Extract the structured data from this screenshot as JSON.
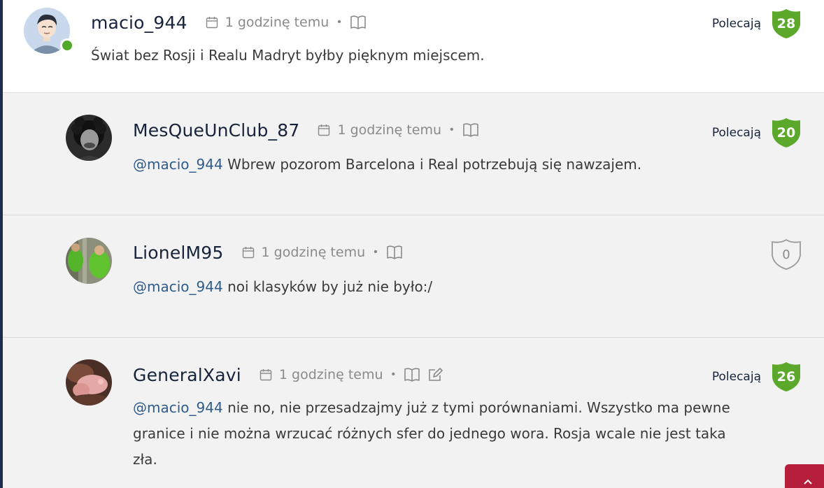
{
  "comments": [
    {
      "username": "macio_944",
      "time": "1 godzinę temu",
      "mention": "",
      "text": "Świat bez Rosji i Realu Madryt byłby pięknym miejscem.",
      "rec_label": "Polecają",
      "score": "28",
      "online": true
    },
    {
      "username": "MesQueUnClub_87",
      "time": "1 godzinę temu",
      "mention": "@macio_944",
      "text": "Wbrew pozorom Barcelona i Real potrzebują się nawzajem.",
      "rec_label": "Polecają",
      "score": "20"
    },
    {
      "username": "LionelM95",
      "time": "1 godzinę temu",
      "mention": "@macio_944",
      "text": "noi klasyków by już nie było:/",
      "rec_label": "",
      "score": "0"
    },
    {
      "username": "GeneralXavi",
      "time": "1 godzinę temu",
      "mention": "@macio_944",
      "text": "nie no, nie przesadzajmy już z tymi porównaniami. Wszystko ma pewne granice i nie można wrzucać różnych sfer do jednego wora. Rosja wcale nie jest taka zła.",
      "rec_label": "Polecają",
      "score": "26"
    }
  ],
  "icons": {
    "calendar": "calendar-icon",
    "quote": "book-icon",
    "edit": "edit-icon",
    "shield": "shield-badge-icon",
    "scroll_top": "chevron-up-icon"
  },
  "colors": {
    "username": "#17233a",
    "mention": "#2f5b8a",
    "meta": "#8a8a8a",
    "badge_green": "#5ba82b",
    "online": "#52a828",
    "scroll_top": "#b51f3c",
    "reply_bg": "#f2f2f2"
  }
}
